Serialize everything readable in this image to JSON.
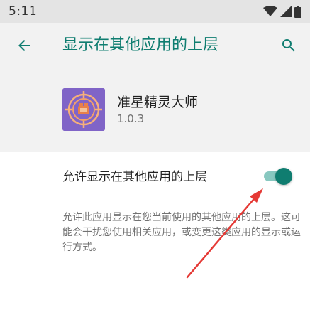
{
  "status_bar": {
    "time": "5:11",
    "icons": [
      "wifi-icon",
      "signal-icon",
      "battery-icon"
    ]
  },
  "app_bar": {
    "title": "显示在其他应用的上层",
    "back_icon": "arrow-left-icon",
    "search_icon": "search-icon"
  },
  "app_info": {
    "name": "准星精灵大师",
    "version": "1.0.3",
    "icon": "crosshair-app-icon"
  },
  "setting": {
    "label": "允许显示在其他应用的上层",
    "enabled": true,
    "description": "允许此应用显示在您当前使用的其他应用的上层。这可能会干扰您使用相关应用，或变更这类应用的显示或运行方式。"
  },
  "colors": {
    "accent": "#0f7d70",
    "switch_track": "#88c8c0",
    "app_icon_bg": "#8064c7",
    "annotation_arrow": "#e53935"
  },
  "annotation": {
    "type": "arrow",
    "points_to": "permission-switch"
  }
}
